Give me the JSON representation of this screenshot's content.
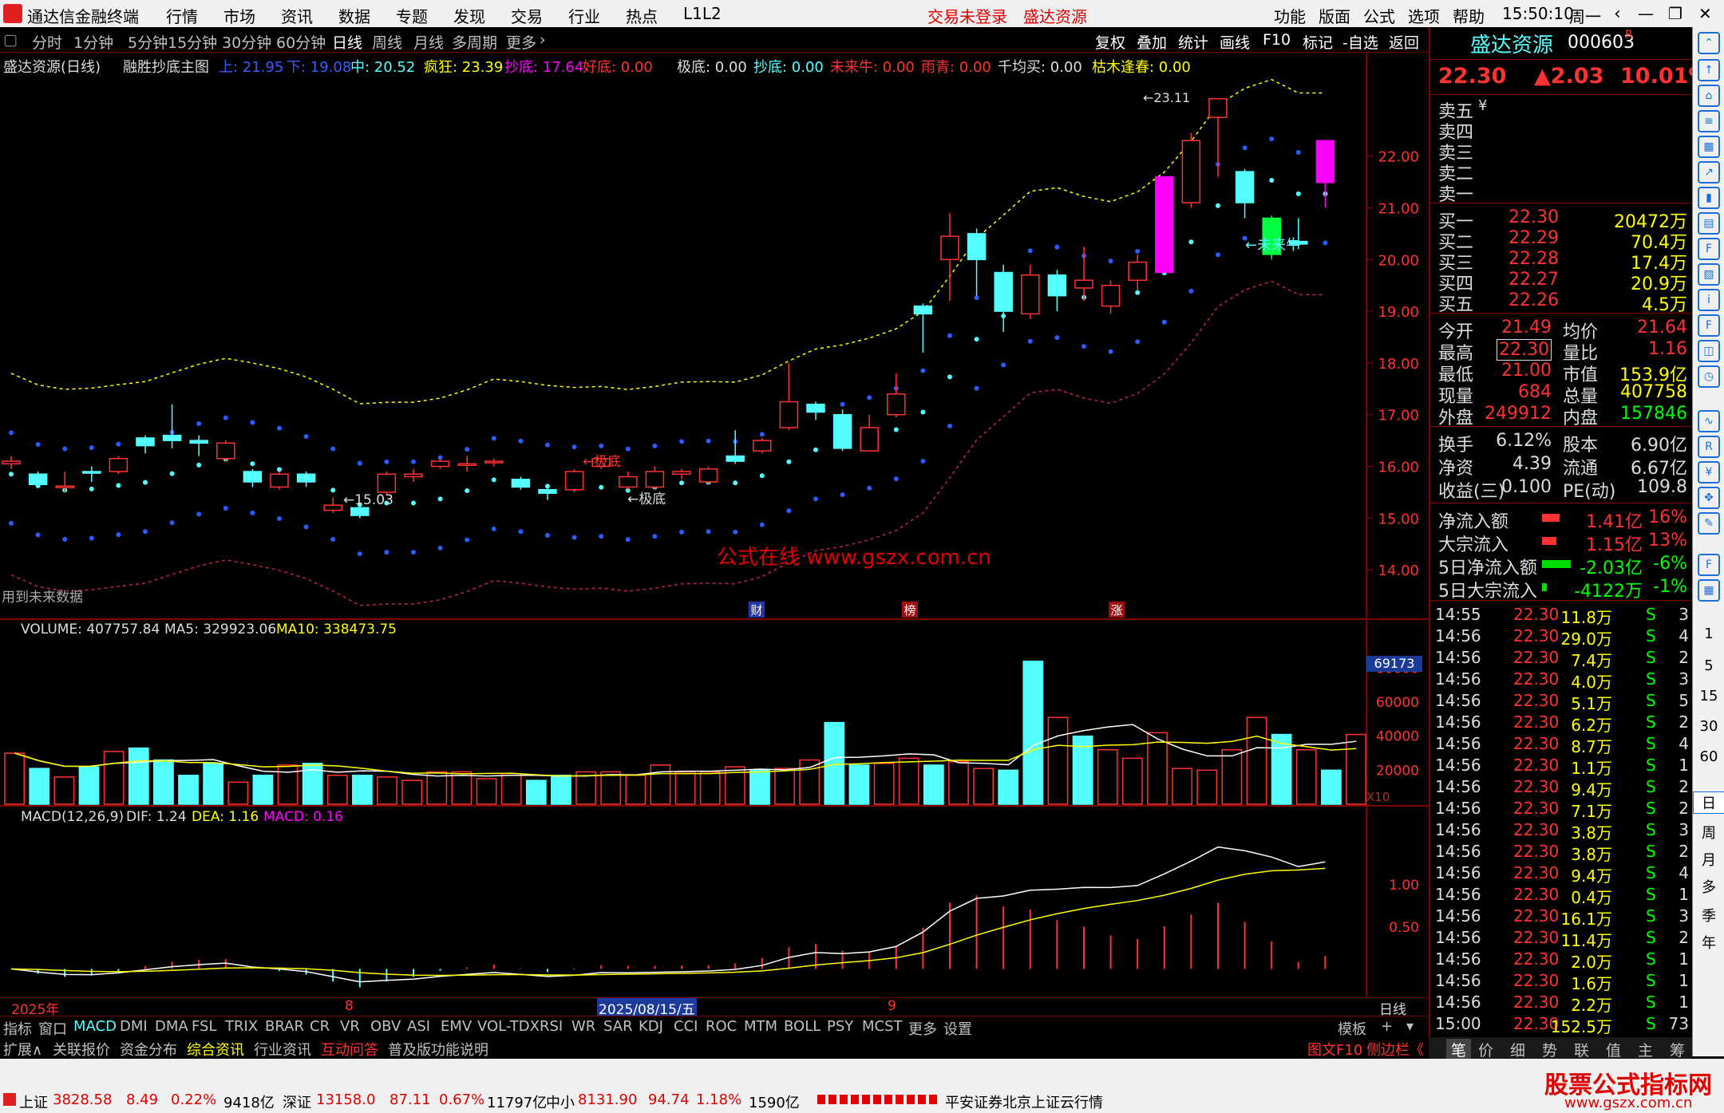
{
  "window": {
    "title": "通达信金融终端",
    "menus": [
      "行情",
      "市场",
      "资讯",
      "数据",
      "专题",
      "发现",
      "交易",
      "行业",
      "热点",
      "L1L2"
    ],
    "login": "交易未登录",
    "stock": "盛达资源",
    "right_menus": [
      "功能",
      "版面",
      "公式",
      "选项",
      "帮助"
    ],
    "time": "15:50:10",
    "weekday": "周一"
  },
  "period_tabs": [
    "分时",
    "1分钟",
    "5分钟",
    "15分钟",
    "30分钟",
    "60分钟",
    "日线",
    "周线",
    "月线",
    "多周期",
    "更多"
  ],
  "active_period": "日线",
  "toolbar": [
    "复权",
    "叠加",
    "统计",
    "画线",
    "F10",
    "标记",
    "-自选",
    "返回"
  ],
  "main_chart": {
    "header": {
      "name": "盛达资源(日线)",
      "formula": "融胜抄底主图",
      "up": "上: 21.95",
      "down": "下: 19.08",
      "mid": "中: 20.52",
      "fk": "疯狂: 23.39",
      "cd": "抄底: 17.64",
      "hd": "好底: 0.00",
      "jd": "极底: 0.00",
      "cd2": "抄底: 0.00",
      "wls": "未来牛: 0.00",
      "yz": "雨青: 0.00",
      "qjm": "千均买: 0.00",
      "kmfc": "枯木逢春: 0.00"
    },
    "note": "用到未来数据",
    "watermark": "公式在线  www.gszx.com.cn",
    "annotations": [
      "←极底",
      "←极底",
      "←15.03",
      "←未来牛",
      "←23.11"
    ],
    "markers": [
      "财",
      "榜",
      "涨"
    ]
  },
  "chart_data": [
    {
      "type": "candlestick",
      "title": "盛达资源(日线)",
      "ylim": [
        13.2,
        23.6
      ],
      "y_ticks": [
        14.0,
        15.0,
        16.0,
        17.0,
        18.0,
        19.0,
        20.0,
        21.0,
        22.0
      ],
      "candles": [
        [
          16.05,
          16.1,
          15.95,
          16.2
        ],
        [
          15.85,
          15.65,
          15.6,
          15.9
        ],
        [
          15.6,
          15.62,
          15.5,
          15.9
        ],
        [
          15.9,
          15.88,
          15.7,
          16.0
        ],
        [
          15.9,
          16.15,
          15.85,
          16.2
        ],
        [
          16.55,
          16.4,
          16.25,
          16.6
        ],
        [
          16.6,
          16.5,
          16.35,
          17.2
        ],
        [
          16.5,
          16.45,
          16.2,
          16.6
        ],
        [
          16.15,
          16.45,
          16.1,
          16.5
        ],
        [
          15.9,
          15.7,
          15.6,
          15.95
        ],
        [
          15.6,
          15.85,
          15.55,
          15.9
        ],
        [
          15.85,
          15.7,
          15.6,
          15.9
        ],
        [
          15.15,
          15.25,
          15.1,
          15.4
        ],
        [
          15.2,
          15.05,
          15.0,
          15.25
        ],
        [
          15.5,
          15.85,
          15.45,
          15.9
        ],
        [
          15.8,
          15.85,
          15.7,
          15.95
        ],
        [
          16.0,
          16.1,
          15.95,
          16.15
        ],
        [
          16.05,
          16.05,
          15.9,
          16.2
        ],
        [
          16.1,
          16.1,
          16.0,
          16.15
        ],
        [
          15.75,
          15.6,
          15.55,
          15.8
        ],
        [
          15.55,
          15.48,
          15.35,
          15.65
        ],
        [
          15.55,
          15.9,
          15.5,
          15.95
        ],
        [
          16.0,
          16.15,
          15.95,
          16.2
        ],
        [
          15.6,
          15.8,
          15.55,
          15.9
        ],
        [
          15.6,
          15.9,
          15.55,
          16.0
        ],
        [
          15.85,
          15.9,
          15.75,
          15.95
        ],
        [
          15.7,
          15.95,
          15.65,
          16.0
        ],
        [
          16.2,
          16.1,
          16.05,
          16.7
        ],
        [
          16.3,
          16.5,
          16.25,
          16.55
        ],
        [
          16.75,
          17.25,
          16.7,
          18.0
        ],
        [
          17.2,
          17.05,
          16.9,
          17.25
        ],
        [
          17.0,
          16.35,
          16.3,
          17.1
        ],
        [
          16.3,
          16.75,
          16.3,
          17.0
        ],
        [
          17.0,
          17.4,
          16.95,
          17.8
        ],
        [
          19.1,
          18.95,
          18.2,
          19.15
        ],
        [
          20.0,
          20.45,
          19.2,
          20.9
        ],
        [
          20.5,
          20.0,
          19.3,
          20.6
        ],
        [
          19.75,
          19.0,
          18.6,
          19.9
        ],
        [
          18.95,
          19.7,
          18.85,
          19.9
        ],
        [
          19.7,
          19.3,
          19.0,
          19.8
        ],
        [
          19.45,
          19.6,
          19.2,
          20.25
        ],
        [
          19.1,
          19.5,
          18.95,
          19.6
        ],
        [
          19.6,
          19.95,
          19.4,
          20.1
        ],
        [
          19.75,
          21.6,
          19.75,
          21.6
        ],
        [
          21.1,
          22.3,
          21.0,
          22.45
        ],
        [
          22.75,
          23.11,
          21.6,
          23.11
        ],
        [
          21.7,
          21.1,
          20.8,
          21.75
        ],
        [
          20.1,
          20.8,
          20.0,
          20.85
        ],
        [
          20.35,
          20.3,
          20.2,
          20.8
        ],
        [
          21.49,
          22.3,
          21.0,
          22.3
        ]
      ]
    },
    {
      "type": "bar",
      "title": "VOLUME",
      "series": [
        {
          "name": "VOLUME",
          "values": [
            30000,
            21000,
            16000,
            22000,
            31000,
            33000,
            26000,
            17000,
            24000,
            13000,
            17000,
            23000,
            24000,
            17000,
            17000,
            16000,
            14000,
            19000,
            19000,
            15000,
            18000,
            14000,
            17000,
            19000,
            19000,
            17000,
            23000,
            19000,
            19000,
            22000,
            20000,
            21000,
            26000,
            48000,
            23000,
            24000,
            27000,
            23000,
            25000,
            21000,
            20000,
            84000,
            51000,
            40000,
            32000,
            27000,
            42000,
            21000,
            20000,
            32000,
            51000,
            41000,
            32000,
            20000,
            41000
          ]
        }
      ],
      "ma5": 329923.06,
      "ma10": 338473.75,
      "last": "407757.84",
      "y_ticks": [
        20000,
        40000,
        60000,
        80000
      ],
      "current": "69173",
      "multiplier": "X10"
    },
    {
      "type": "line",
      "title": "MACD(12,26,9)",
      "DIF": 1.24,
      "DEA": 1.16,
      "MACD": 0.16,
      "y_ticks": [
        0.5,
        1.0
      ]
    }
  ],
  "timeline": {
    "labels": [
      "2025年",
      "8",
      "2025/08/15/五",
      "9",
      "日线"
    ]
  },
  "quote": {
    "name": "盛达资源",
    "code": "000603",
    "r": "R",
    "price": "22.30",
    "change": "▲2.03",
    "pct": "10.01%",
    "asks": [
      "卖五",
      "卖四",
      "卖三",
      "卖二",
      "卖一"
    ],
    "ask_sym": "¥",
    "bids": [
      [
        "买一",
        "22.30",
        "20472万"
      ],
      [
        "买二",
        "22.29",
        "70.4万"
      ],
      [
        "买三",
        "22.28",
        "17.4万"
      ],
      [
        "买四",
        "22.27",
        "20.9万"
      ],
      [
        "买五",
        "22.26",
        "4.5万"
      ]
    ],
    "stats": [
      [
        "今开",
        "21.49",
        "均价",
        "21.64"
      ],
      [
        "最高",
        "22.30",
        "量比",
        "1.16"
      ],
      [
        "最低",
        "21.00",
        "市值",
        "153.9亿"
      ],
      [
        "现量",
        "684",
        "总量",
        "407758"
      ],
      [
        "外盘",
        "249912",
        "内盘",
        "157846"
      ]
    ],
    "stats2": [
      [
        "换手",
        "6.12%",
        "股本",
        "6.90亿"
      ],
      [
        "净资",
        "4.39",
        "流通",
        "6.67亿"
      ],
      [
        "收益(三)",
        "0.100",
        "PE(动)",
        "109.8"
      ]
    ],
    "flows": [
      [
        "净流入额",
        "1.41亿",
        "16%"
      ],
      [
        "大宗流入",
        "1.15亿",
        "13%"
      ],
      [
        "5日净流入额",
        "-2.03亿",
        "-6%"
      ],
      [
        "5日大宗流入",
        "-4122万",
        "-1%"
      ]
    ],
    "ticks": [
      [
        "14:55",
        "22.30",
        "11.8万",
        "S",
        "3"
      ],
      [
        "14:56",
        "22.30",
        "29.0万",
        "S",
        "4"
      ],
      [
        "14:56",
        "22.30",
        "7.4万",
        "S",
        "2"
      ],
      [
        "14:56",
        "22.30",
        "4.0万",
        "S",
        "3"
      ],
      [
        "14:56",
        "22.30",
        "5.1万",
        "S",
        "5"
      ],
      [
        "14:56",
        "22.30",
        "6.2万",
        "S",
        "2"
      ],
      [
        "14:56",
        "22.30",
        "8.7万",
        "S",
        "4"
      ],
      [
        "14:56",
        "22.30",
        "1.1万",
        "S",
        "1"
      ],
      [
        "14:56",
        "22.30",
        "9.4万",
        "S",
        "2"
      ],
      [
        "14:56",
        "22.30",
        "7.1万",
        "S",
        "2"
      ],
      [
        "14:56",
        "22.30",
        "3.8万",
        "S",
        "3"
      ],
      [
        "14:56",
        "22.30",
        "3.8万",
        "S",
        "2"
      ],
      [
        "14:56",
        "22.30",
        "9.4万",
        "S",
        "4"
      ],
      [
        "14:56",
        "22.30",
        "0.4万",
        "S",
        "1"
      ],
      [
        "14:56",
        "22.30",
        "16.1万",
        "S",
        "3"
      ],
      [
        "14:56",
        "22.30",
        "11.4万",
        "S",
        "2"
      ],
      [
        "14:56",
        "22.30",
        "2.0万",
        "S",
        "1"
      ],
      [
        "14:56",
        "22.30",
        "1.6万",
        "S",
        "1"
      ],
      [
        "14:56",
        "22.30",
        "2.2万",
        "S",
        "1"
      ],
      [
        "15:00",
        "22.30",
        "152.5万",
        "S",
        "73"
      ]
    ]
  },
  "indicator_tabs": [
    "指标",
    "窗口",
    "MACD",
    "DMI",
    "DMA",
    "FSL",
    "TRIX",
    "BRAR",
    "CR",
    "VR",
    "OBV",
    "ASI",
    "EMV",
    "VOL-TDX",
    "RSI",
    "WR",
    "SAR",
    "KDJ",
    "CCI",
    "ROC",
    "MTM",
    "BOLL",
    "PSY",
    "MCST",
    "更多",
    "设置"
  ],
  "template_btn": "模板",
  "bottom_tabs": [
    "扩展∧",
    "关联报价",
    "资金分布",
    "综合资讯",
    "行业资讯",
    "互动问答",
    "普及版功能说明"
  ],
  "right_bottom": [
    "图文F10",
    "侧边栏《"
  ],
  "right_tabs": [
    "笔",
    "价",
    "细",
    "势",
    "联",
    "值",
    "主",
    "筹"
  ],
  "side_labels": [
    "1",
    "5",
    "15",
    "30",
    "60",
    "日",
    "周",
    "月",
    "多",
    "季",
    "年"
  ],
  "status": {
    "sh": "上证",
    "sh_v": "3828.58",
    "sh_c": "8.49",
    "sh_p": "0.22%",
    "sh_a": "9418亿",
    "sz": "深证",
    "sz_v": "13158.0",
    "sz_c": "87.11",
    "sz_p": "0.67%",
    "sz_a": "11797亿",
    "zx": "中小",
    "zx_v": "8131.90",
    "zx_c": "94.74",
    "zx_p": "1.18%",
    "zx_a": "1590亿",
    "broker": "平安证券北京上证云行情"
  },
  "brand": {
    "line1": "股票公式指标网",
    "line2": "www.gszx.com.cn"
  },
  "colors": {
    "up": "#ff3232",
    "down": "#54ffff",
    "accent": "#ff00ff",
    "yellow": "#ffff00"
  }
}
